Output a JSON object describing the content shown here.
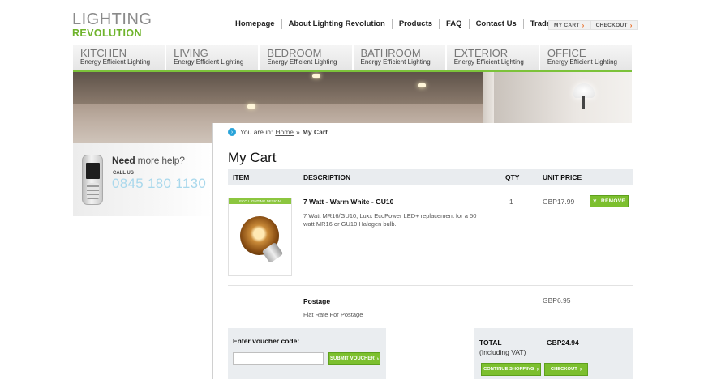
{
  "logo": {
    "line1": "LIGHTING",
    "line2": "REVOLUTION"
  },
  "topnav": [
    {
      "label": "Homepage"
    },
    {
      "label": "About Lighting Revolution"
    },
    {
      "label": "Products"
    },
    {
      "label": "FAQ"
    },
    {
      "label": "Contact Us"
    },
    {
      "label": "Trade Enquiries"
    }
  ],
  "cart_buttons": {
    "my_cart": "MY CART",
    "checkout": "CHECKOUT",
    "arrow": "›"
  },
  "categories": [
    {
      "name": "KITCHEN",
      "sub": "Energy Efficient Lighting"
    },
    {
      "name": "LIVING",
      "sub": "Energy Efficient Lighting"
    },
    {
      "name": "BEDROOM",
      "sub": "Energy Efficient Lighting"
    },
    {
      "name": "BATHROOM",
      "sub": "Energy Efficient Lighting"
    },
    {
      "name": "EXTERIOR",
      "sub": "Energy Efficient Lighting"
    },
    {
      "name": "OFFICE",
      "sub": "Energy Efficient Lighting"
    }
  ],
  "help": {
    "need": "Need",
    "more_help": " more help?",
    "call_us": "CALL US",
    "phone": "0845 180 1130"
  },
  "breadcrumb": {
    "prefix": "You are in:",
    "home": "Home",
    "separator": "»",
    "current": "My Cart"
  },
  "page_title": "My Cart",
  "table_headers": {
    "item": "ITEM",
    "description": "DESCRIPTION",
    "qty": "QTY",
    "unit_price": "UNIT PRICE"
  },
  "cart_item": {
    "image_tag": "ECO LIGHTING DESIGN",
    "name": "7 Watt - Warm White - GU10",
    "description": "7 Watt MR16/GU10, Luxx EcoPower LED+ replacement for a 50 watt MR16 or GU10 Halogen bulb.",
    "qty": "1",
    "unit_price": "GBP17.99",
    "remove_label": "REMOVE",
    "remove_icon": "×"
  },
  "postage": {
    "label": "Postage",
    "description": "Flat Rate For Postage",
    "price": "GBP6.95"
  },
  "voucher": {
    "label": "Enter voucher code:",
    "value": "",
    "placeholder": "",
    "button": "SUBMIT VOUCHER"
  },
  "total": {
    "label": "TOTAL",
    "vat": "(Including VAT)",
    "value": "GBP24.94",
    "continue": "CONTINUE SHOPPING",
    "checkout": "CHECKOUT"
  },
  "colors": {
    "accent_green": "#7cbf2e",
    "info_blue": "#29a3d9",
    "phone_blue": "#a9d8ec",
    "checkout_arrow": "#e8651a"
  }
}
